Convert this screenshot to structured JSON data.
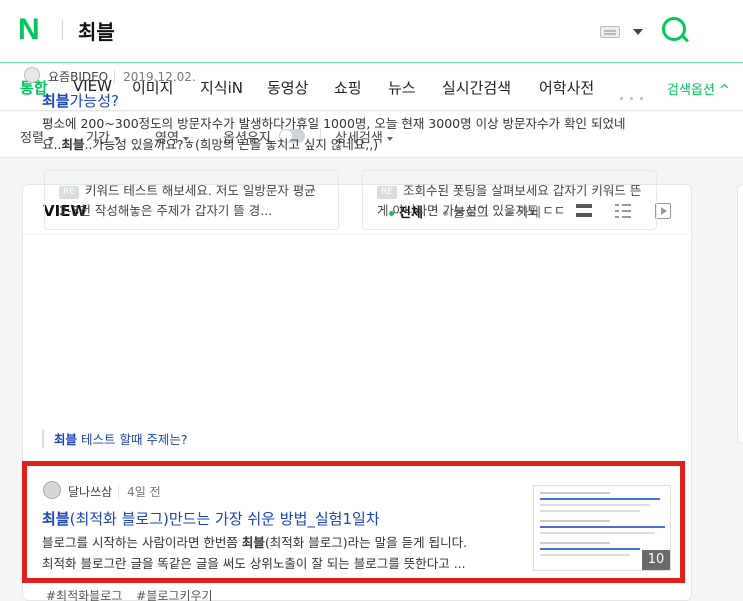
{
  "header": {
    "logo": "N",
    "query": "최블"
  },
  "tabs": [
    {
      "label": "통합",
      "active": true
    },
    {
      "label": "VIEW"
    },
    {
      "label": "이미지"
    },
    {
      "label": "지식iN"
    },
    {
      "label": "동영상"
    },
    {
      "label": "쇼핑"
    },
    {
      "label": "뉴스"
    },
    {
      "label": "실시간검색"
    },
    {
      "label": "어학사전"
    }
  ],
  "search_options": "검색옵션 ^",
  "filters": {
    "sort": "정렬",
    "period": "기간",
    "area": "영역",
    "keep_options": "옵션유지",
    "detail": "상세검색"
  },
  "view": {
    "title": "VIEW",
    "filter_all": "전체",
    "filter_blog": "블로그",
    "filter_cafe": "카페"
  },
  "post1": {
    "author": "요즘BIDEO",
    "date": "2019.12.02.",
    "title_hl": "최블",
    "title_rest": "가능성?",
    "desc_line1": "평소에 200~300정도의 방문자수가 발생하다가휴일 1000명, 오늘 현재 3000명 이상 방문자수가 확인 되었네",
    "desc_line2_pre": "요..",
    "desc_line2_hl": "최블",
    "desc_line2_post": "..가능성 있을까요?ㅎ(희망의 끈을 놓치고 싶지 않네요,,)",
    "re_label": "RE",
    "reply1": "키워드 테스트 해보세요. 저도 일방문자 평균 2-3천 작성해놓은 주제가 갑자기 뜰 경...",
    "reply2": "조회수된 폿팅을 살펴보세요 갑자기 키워드 뜬게 아니라면 가능성이 있을지도 ㄷㄷ",
    "related_hl": "최블",
    "related_rest": " 테스트 할때 주제는?"
  },
  "post2": {
    "author": "달나쓰삼",
    "date": "4일 전",
    "title_hl": "최블",
    "title_rest": "(최적화 블로그)만드는 가장 쉬운 방법_실험1일차",
    "desc_line1_pre": "블로그를 시작하는 사람이라면 한번쯤 ",
    "desc_line1_hl": "최블",
    "desc_line1_post": "(최적화 블로그)라는 말을 듣게 됩니다.",
    "desc_line2": "최적화 블로그란 글을 똑같은 글을 써도 상위노출이 잘 되는 블로그를 뜻한다고 ...",
    "thumb_count": "10",
    "tags": [
      "#최적화블로그",
      "#블로그키우기"
    ]
  },
  "colors": {
    "brand": "#03c75a",
    "link": "#1a44bf",
    "highlight_border": "#e0201c"
  }
}
